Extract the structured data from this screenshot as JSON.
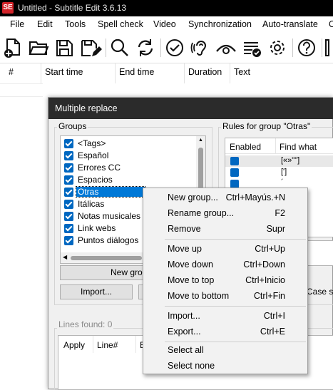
{
  "window": {
    "app_icon": "SE",
    "title": "Untitled - Subtitle Edit 3.6.13"
  },
  "menu": [
    "File",
    "Edit",
    "Tools",
    "Spell check",
    "Video",
    "Synchronization",
    "Auto-translate",
    "O"
  ],
  "toolbar": [
    "new-file-icon",
    "open-folder-icon",
    "save-icon",
    "save-as-icon",
    "find-icon",
    "replace-icon",
    "spell-check-icon",
    "hearing-icon",
    "visual-sync-icon",
    "batch-convert-icon",
    "settings-icon",
    "help-icon",
    "layout-icon"
  ],
  "grid": {
    "columns": [
      "#",
      "Start time",
      "End time",
      "Duration",
      "Text"
    ]
  },
  "dialog": {
    "title": "Multiple replace",
    "groups_label": "Groups",
    "groups": [
      {
        "label": "<Tags>",
        "checked": true
      },
      {
        "label": "Español",
        "checked": true
      },
      {
        "label": "Errores CC",
        "checked": true
      },
      {
        "label": "Espacios",
        "checked": true
      },
      {
        "label": "Otras",
        "checked": true,
        "selected": true
      },
      {
        "label": "Itálicas",
        "checked": true
      },
      {
        "label": "Notas musicales",
        "checked": true
      },
      {
        "label": "Link webs",
        "checked": true
      },
      {
        "label": "Puntos diálogos",
        "checked": true
      }
    ],
    "new_group_button": "New grou",
    "import_button": "Import...",
    "rules_label": "Rules for group \"Otras\"",
    "rules_columns": [
      "Enabled",
      "Find what"
    ],
    "rules_rows": [
      "[«»\"\"]",
      "[']",
      "´"
    ],
    "case_sensitive_label": "Case se",
    "lines_found_label": "Lines found: 0",
    "lines_columns": [
      "Apply",
      "Line#",
      "B"
    ]
  },
  "context_menu": {
    "sections": [
      [
        {
          "label": "New group...",
          "shortcut": "Ctrl+Mayús.+N"
        },
        {
          "label": "Rename group...",
          "shortcut": "F2"
        },
        {
          "label": "Remove",
          "shortcut": "Supr"
        }
      ],
      [
        {
          "label": "Move up",
          "shortcut": "Ctrl+Up"
        },
        {
          "label": "Move down",
          "shortcut": "Ctrl+Down"
        },
        {
          "label": "Move to top",
          "shortcut": "Ctrl+Inicio"
        },
        {
          "label": "Move to bottom",
          "shortcut": "Ctrl+Fin"
        }
      ],
      [
        {
          "label": "Import...",
          "shortcut": "Ctrl+I"
        },
        {
          "label": "Export...",
          "shortcut": "Ctrl+E"
        }
      ],
      [
        {
          "label": "Select all",
          "shortcut": ""
        },
        {
          "label": "Select none",
          "shortcut": ""
        }
      ]
    ]
  },
  "colors": {
    "selection": "#0078d7",
    "checkbox": "#0067c0",
    "titlebar": "#000000",
    "app_icon": "#d3242a"
  }
}
